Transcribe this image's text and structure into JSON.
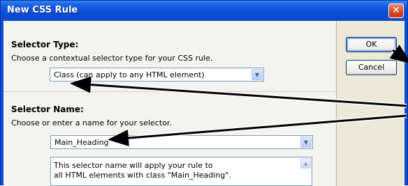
{
  "window": {
    "title": "New CSS Rule",
    "close_glyph": "✕"
  },
  "selector_type": {
    "heading": "Selector Type:",
    "description": "Choose a contextual selector type for your CSS rule.",
    "value": "Class (can apply to any HTML element)"
  },
  "selector_name": {
    "heading": "Selector Name:",
    "description": "Choose or enter a name for your selector.",
    "value": "Main_Heading",
    "info_lines": [
      "This selector name will apply your rule to",
      "all HTML elements with class \"Main_Heading\"."
    ]
  },
  "buttons": {
    "ok": "OK",
    "cancel": "Cancel"
  },
  "icons": {
    "dropdown": "chevron-down-icon",
    "scroll": "scroll-up-icon",
    "close": "close-icon"
  },
  "colors": {
    "title_bar": "#0b4fd8",
    "close": "#d5471e",
    "arrow": "#000000"
  }
}
